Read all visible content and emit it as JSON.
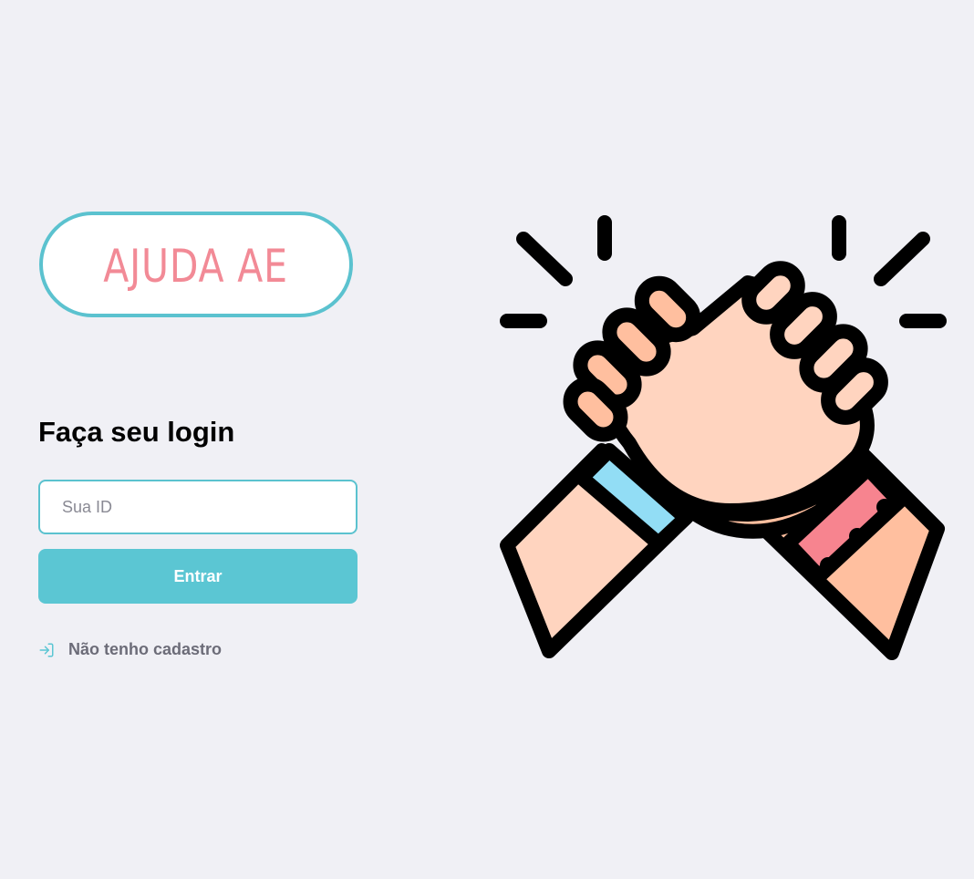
{
  "logo": {
    "text": "AJUDA AE"
  },
  "login": {
    "title": "Faça seu login",
    "id_placeholder": "Sua ID",
    "submit_label": "Entrar",
    "register_label": "Não tenho cadastro"
  },
  "icons": {
    "register": "log-in-icon",
    "hero": "handshake-illustration"
  },
  "colors": {
    "background": "#f0f0f5",
    "accent": "#5bc6d3",
    "logo_text": "#f28a96",
    "muted_text": "#6c6c78"
  }
}
